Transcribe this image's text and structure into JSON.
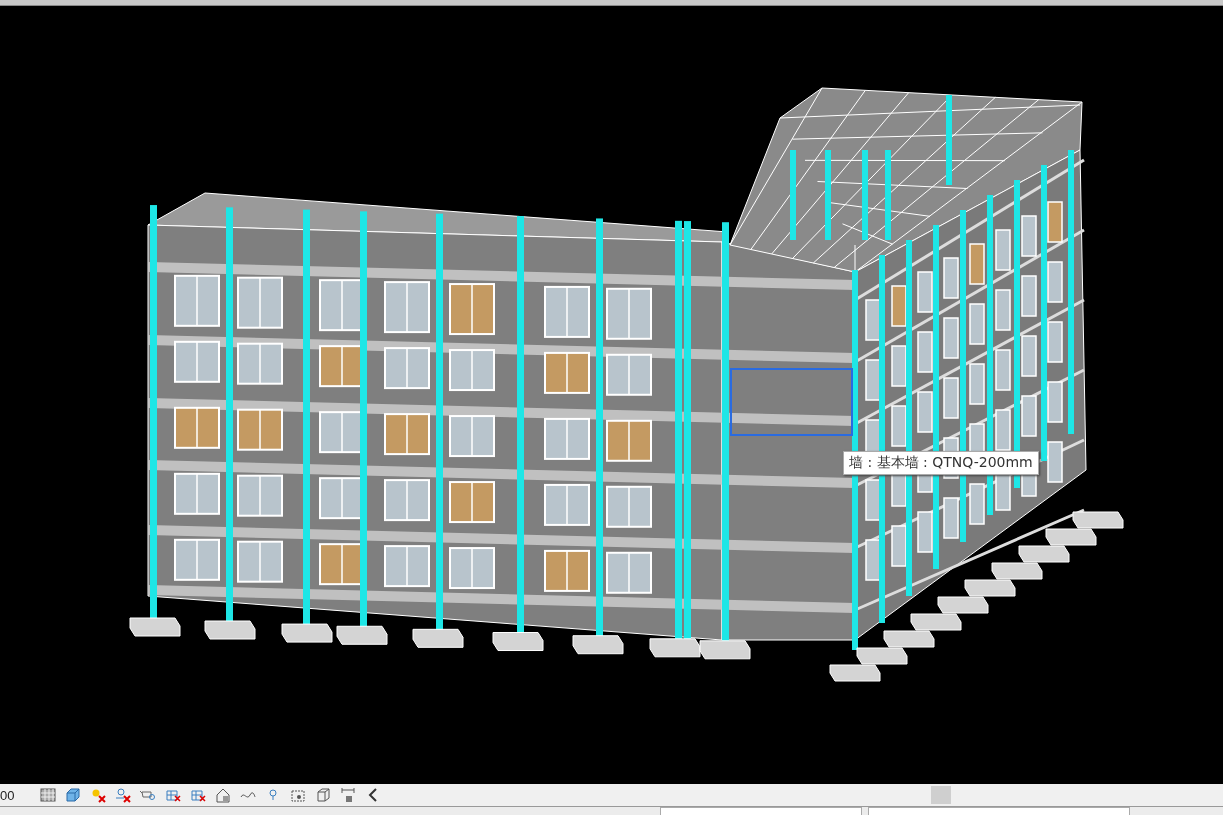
{
  "viewport": {
    "tooltip": "墙 : 基本墙 : QTNQ-200mm"
  },
  "view_control_bar": {
    "scale": "00"
  }
}
